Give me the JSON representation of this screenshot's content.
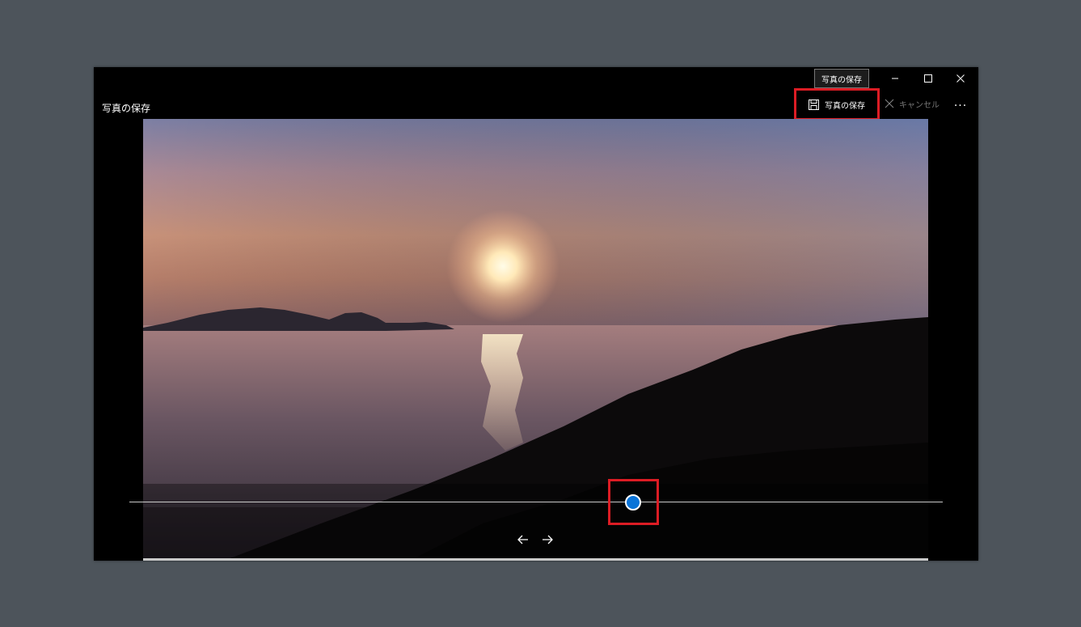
{
  "window": {
    "title": "写真の保存"
  },
  "tooltip": {
    "text": "写真の保存"
  },
  "caption": {
    "minimize_icon": "minimize-icon",
    "maximize_icon": "maximize-icon",
    "close_icon": "close-icon"
  },
  "toolbar": {
    "save_label": "写真の保存",
    "save_icon": "floppy-disk-icon",
    "cancel_label": "キャンセル",
    "cancel_icon": "x-icon",
    "more_label": "..."
  },
  "photo": {
    "description_icon": "sunset-photo"
  },
  "navigation": {
    "prev_icon": "arrow-left-icon",
    "next_icon": "arrow-right-icon"
  },
  "scrubber": {
    "position_fraction": 0.62,
    "accent_color": "#0a74d8",
    "highlight_color": "#dc1c24"
  }
}
